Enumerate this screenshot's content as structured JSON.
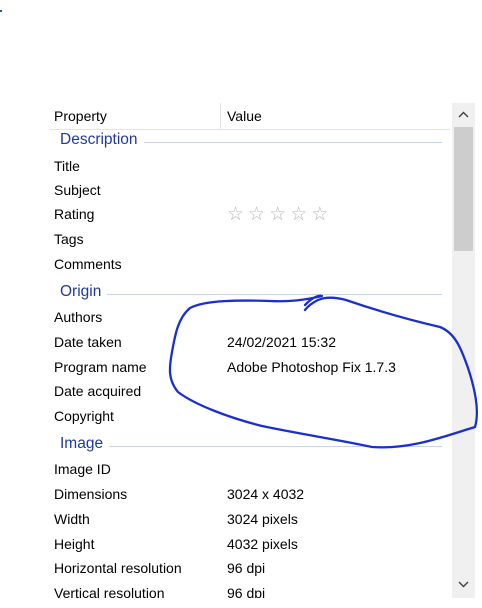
{
  "columns": {
    "property": "Property",
    "value": "Value"
  },
  "groups": {
    "description": "Description",
    "origin": "Origin",
    "image": "Image"
  },
  "description_rows": [
    {
      "label": "Title",
      "value": ""
    },
    {
      "label": "Subject",
      "value": ""
    },
    {
      "label": "Rating",
      "value": ""
    },
    {
      "label": "Tags",
      "value": ""
    },
    {
      "label": "Comments",
      "value": ""
    }
  ],
  "rating": {
    "stars_filled": 0,
    "stars_total": 5,
    "glyph": "☆"
  },
  "origin_rows": [
    {
      "label": "Authors",
      "value": ""
    },
    {
      "label": "Date taken",
      "value": "24/02/2021 15:32"
    },
    {
      "label": "Program name",
      "value": "Adobe Photoshop Fix 1.7.3"
    },
    {
      "label": "Date acquired",
      "value": ""
    },
    {
      "label": "Copyright",
      "value": ""
    }
  ],
  "image_rows": [
    {
      "label": "Image ID",
      "value": ""
    },
    {
      "label": "Dimensions",
      "value": "3024 x 4032"
    },
    {
      "label": "Width",
      "value": "3024 pixels"
    },
    {
      "label": "Height",
      "value": "4032 pixels"
    },
    {
      "label": "Horizontal resolution",
      "value": "96 dpi"
    },
    {
      "label": "Vertical resolution",
      "value": "96 dpi"
    }
  ],
  "colors": {
    "group_title": "#1e3aa0",
    "annotation_ink": "#1a2fd0"
  },
  "icons": {
    "scroll_up": "chevron-up-icon",
    "scroll_down": "chevron-down-icon"
  }
}
